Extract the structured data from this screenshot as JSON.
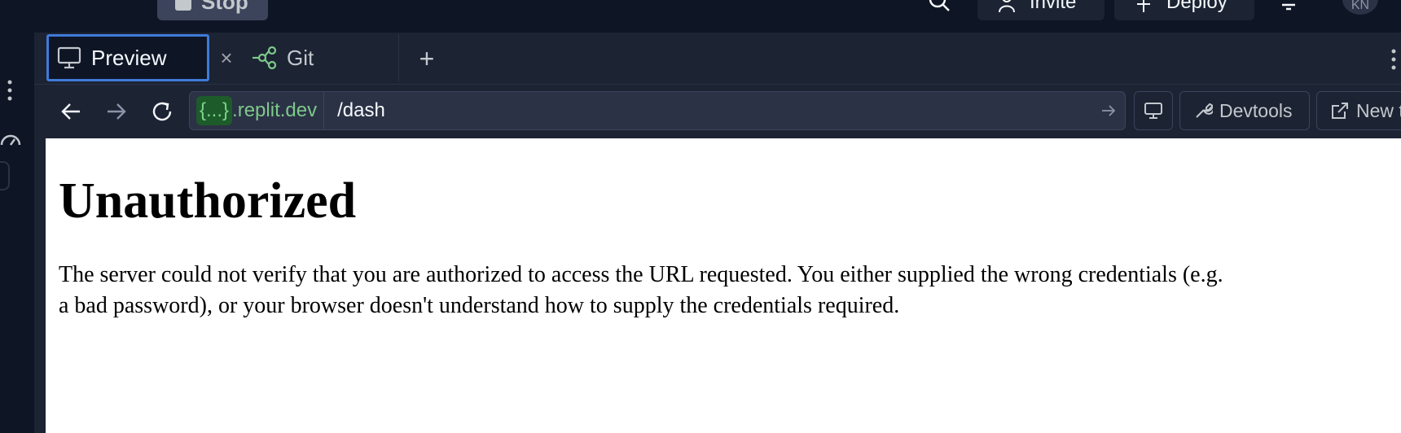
{
  "topbar": {
    "stop_label": "Stop",
    "invite_label": "Invite",
    "deploy_label": "Deploy",
    "avatar_initials": "KN"
  },
  "tabs": [
    {
      "label": "Preview",
      "icon": "monitor-icon",
      "active": true
    },
    {
      "label": "Git",
      "icon": "git-branch-icon",
      "active": false
    }
  ],
  "navbar": {
    "domain_pill": "{...}",
    "domain_suffix": ".replit.dev",
    "path": "/dash",
    "devtools_label": "Devtools",
    "newtab_label": "New tab"
  },
  "page": {
    "heading": "Unauthorized",
    "message_line1": "The server could not verify that you are authorized to access the URL requested. You either supplied the wrong credentials (e.g.",
    "message_line2": "a bad password), or your browser doesn't understand how to supply the credentials required."
  },
  "colors": {
    "background": "#0e1525",
    "panel": "#1c2333",
    "active_tab_border": "#3f7ad9",
    "domain_green": "#7dc98a"
  }
}
